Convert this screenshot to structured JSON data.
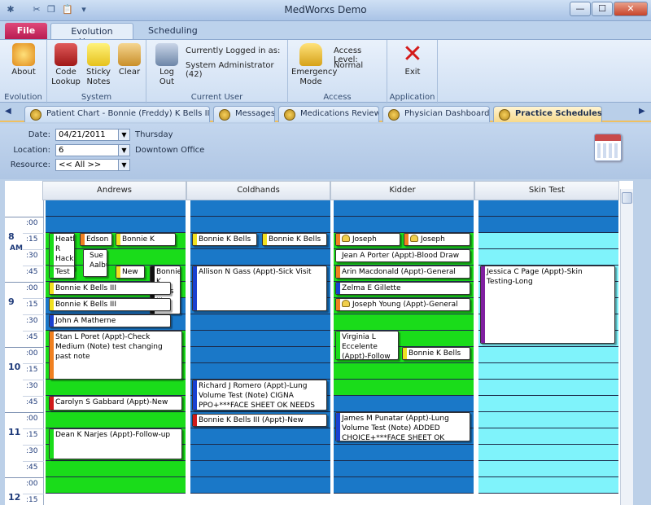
{
  "window": {
    "title": "MedWorxs Demo",
    "minimize": "—",
    "maximize": "☐",
    "close": "✕"
  },
  "ribbon_tabs": {
    "file": "File",
    "home": "Evolution Home",
    "scheduling": "Scheduling"
  },
  "ribbon": {
    "about": "About",
    "evolution_group": "Evolution",
    "code_lookup": "Code Lookup",
    "sticky_notes": "Sticky Notes",
    "clear": "Clear",
    "system_group": "System",
    "logout": "Log Out",
    "logged_in_label": "Currently Logged in as:",
    "logged_in_user": "System Administrator (42)",
    "current_user_group": "Current User",
    "emergency_mode": "Emergency Mode",
    "access_level_label": "Access Level:",
    "access_level_value": "Normal",
    "access_group": "Access",
    "exit": "Exit",
    "application_group": "Application"
  },
  "doc_tabs": [
    "Patient Chart - Bonnie (Freddy) K Bells III",
    "Messages",
    "Medications Review",
    "Physician Dashboard",
    "Practice Schedules..."
  ],
  "filters": {
    "date_label": "Date:",
    "date_value": "04/21/2011",
    "date_day": "Thursday",
    "location_label": "Location:",
    "location_value": "6",
    "location_name": "Downtown Office",
    "resource_label": "Resource:",
    "resource_value": "<< All >>"
  },
  "columns": [
    "Andrews",
    "Coldhands",
    "Kidder",
    "Skin Test"
  ],
  "time": {
    "hours": [
      "8",
      "9",
      "10",
      "11",
      "12"
    ],
    "ampm": "AM",
    "minutes": [
      ":00",
      ":15",
      ":30",
      ":45"
    ]
  },
  "colors": {
    "blue": "#1a78c8",
    "green": "#1adc1a",
    "cyan": "#7ff3fb"
  },
  "appointments": [
    {
      "text": "Heather R Hack"
    },
    {
      "text": "Edson"
    },
    {
      "text": "Bonnie K Bells"
    },
    {
      "text": "Sue Aalbu"
    },
    {
      "text": "Test"
    },
    {
      "text": "New"
    },
    {
      "text": "Bonnie K Bells III"
    },
    {
      "text": "Bonnie K Bells III"
    },
    {
      "text": "Bonnie K Bells III"
    },
    {
      "text": "John A Matherne"
    },
    {
      "text": "Stan L Poret  (Appt)-Check Medium (Note) test changing past note"
    },
    {
      "text": "Carolyn S Gabbard  (Appt)-New"
    },
    {
      "text": "Dean K Narjes  (Appt)-Follow-up"
    },
    {
      "text": "Bonnie K Bells"
    },
    {
      "text": "Bonnie K Bells"
    },
    {
      "text": "Allison N Gass  (Appt)-Sick Visit"
    },
    {
      "text": "Richard J Romero  (Appt)-Lung Volume Test (Note) CIGNA PPO+***FACE SHEET OK NEEDS ALL"
    },
    {
      "text": "Bonnie K Bells III  (Appt)-New"
    },
    {
      "text": "Joseph  Young"
    },
    {
      "text": "Joseph  Young"
    },
    {
      "text": "Jean A Porter  (Appt)-Blood Draw"
    },
    {
      "text": "Arin  Macdonald  (Appt)-General"
    },
    {
      "text": "Zelma E Gillette"
    },
    {
      "text": "Joseph  Young  (Appt)-General"
    },
    {
      "text": "Virginia L Eccelente  (Appt)-Follow"
    },
    {
      "text": "Bonnie K Bells"
    },
    {
      "text": "James M Punatar  (Appt)-Lung Volume Test (Note) ADDED CHOICE+***FACE SHEET OK NEEDS"
    },
    {
      "text": "Jessica C Page  (Appt)-Skin Testing-Long"
    }
  ]
}
